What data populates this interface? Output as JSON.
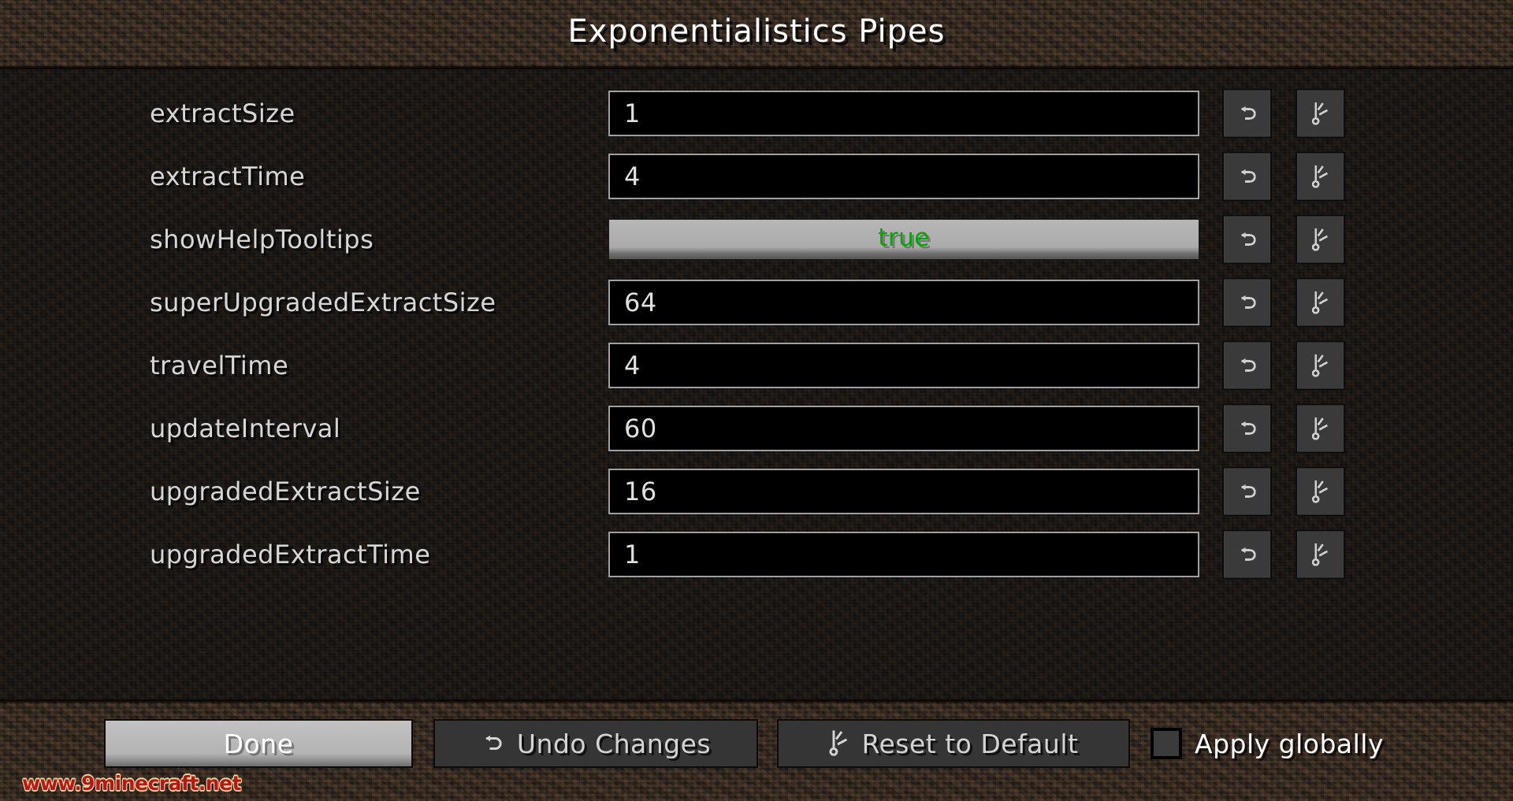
{
  "header": {
    "title": "Exponentialistics Pipes"
  },
  "options": [
    {
      "name": "extractSize",
      "widget": "text",
      "value": "1",
      "undo_icon": "undo-arrow-icon",
      "reset_icon": "reset-wand-icon"
    },
    {
      "name": "extractTime",
      "widget": "text",
      "value": "4",
      "undo_icon": "undo-arrow-icon",
      "reset_icon": "reset-wand-icon"
    },
    {
      "name": "showHelpTooltips",
      "widget": "toggle",
      "value": "true",
      "value_color": "#00a800",
      "undo_icon": "undo-arrow-icon",
      "reset_icon": "reset-wand-icon"
    },
    {
      "name": "superUpgradedExtractSize",
      "widget": "text",
      "value": "64",
      "undo_icon": "undo-arrow-icon",
      "reset_icon": "reset-wand-icon"
    },
    {
      "name": "travelTime",
      "widget": "text",
      "value": "4",
      "undo_icon": "undo-arrow-icon",
      "reset_icon": "reset-wand-icon"
    },
    {
      "name": "updateInterval",
      "widget": "text",
      "value": "60",
      "undo_icon": "undo-arrow-icon",
      "reset_icon": "reset-wand-icon"
    },
    {
      "name": "upgradedExtractSize",
      "widget": "text",
      "value": "16",
      "undo_icon": "undo-arrow-icon",
      "reset_icon": "reset-wand-icon"
    },
    {
      "name": "upgradedExtractTime",
      "widget": "text",
      "value": "1",
      "undo_icon": "undo-arrow-icon",
      "reset_icon": "reset-wand-icon"
    }
  ],
  "footer": {
    "done_label": "Done",
    "undo_label": "Undo Changes",
    "undo_icon": "undo-arrow-icon",
    "reset_label": "Reset to Default",
    "reset_icon": "reset-wand-icon",
    "apply_globally_label": "Apply globally",
    "apply_globally_checked": false
  },
  "watermark": {
    "text": "www.9minecraft.net",
    "color": "#b41818"
  }
}
